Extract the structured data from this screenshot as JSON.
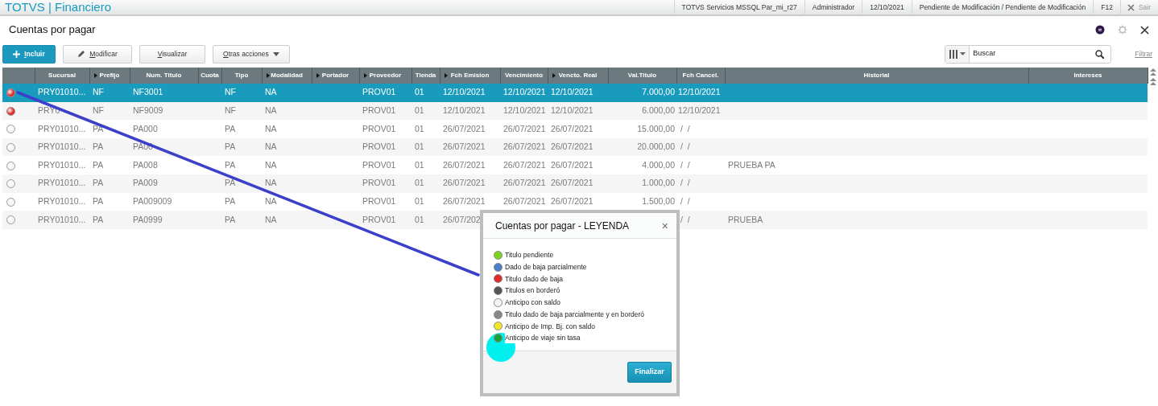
{
  "app_bar": {
    "title": "TOTVS | Financiero",
    "items": [
      "TOTVS Servicios MSSQL Par_mi_r27",
      "Administrador",
      "12/10/2021",
      "Pendiente de Modificación / Pendiente de Modificación",
      "F12"
    ],
    "exit": "Sair"
  },
  "page": {
    "title": "Cuentas por pagar"
  },
  "toolbar": {
    "buttons": [
      {
        "label": "Incluir",
        "kind": "primary"
      },
      {
        "label": "Modificar",
        "kind": "edit"
      },
      {
        "label": "Visualizar",
        "kind": "plain"
      },
      {
        "label": "Otras acciones",
        "kind": "dropdown"
      }
    ],
    "search": {
      "placeholder": "Buscar"
    },
    "filter": "Filtrar"
  },
  "table": {
    "columns": [
      {
        "label": "Sucursal",
        "sort_arrow": false
      },
      {
        "label": "Prefijo",
        "sort_arrow": true
      },
      {
        "label": "Num. Titulo",
        "sort_arrow": false
      },
      {
        "label": "Cuota",
        "sort_arrow": false
      },
      {
        "label": "Tipo",
        "sort_arrow": false
      },
      {
        "label": "Modalidad",
        "sort_arrow": true
      },
      {
        "label": "Portador",
        "sort_arrow": true
      },
      {
        "label": "Proveedor",
        "sort_arrow": true
      },
      {
        "label": "Tienda",
        "sort_arrow": false
      },
      {
        "label": "Fch Emision",
        "sort_arrow": true
      },
      {
        "label": "Vencimiento",
        "sort_arrow": false
      },
      {
        "label": "Vencto. Real",
        "sort_arrow": true
      },
      {
        "label": "Val.Titulo",
        "sort_arrow": false
      },
      {
        "label": "Fch Cancel.",
        "sort_arrow": false
      },
      {
        "label": "Historial",
        "sort_arrow": false
      },
      {
        "label": "Intereses",
        "sort_arrow": false
      }
    ],
    "rows": [
      {
        "color": "#e02b2b",
        "selected": true,
        "cells": [
          "PRY01010...",
          "NF",
          "NF3001",
          null,
          "NF",
          "NA",
          null,
          "PROV01",
          "01",
          "12/10/2021",
          "12/10/2021",
          "12/10/2021",
          "7.000,00",
          "12/10/2021",
          null,
          null
        ]
      },
      {
        "color": "#e02b2b",
        "selected": false,
        "cells": [
          "PRY0",
          "NF",
          "NF9009",
          null,
          "NF",
          "NA",
          null,
          "PROV01",
          "01",
          "12/10/2021",
          "12/10/2021",
          "12/10/2021",
          "6.000,00",
          "12/10/2021",
          null,
          null
        ]
      },
      {
        "color": "#f4f4f4",
        "selected": false,
        "cells": [
          "PRY01010...",
          "PA",
          "PA000",
          null,
          "PA",
          "NA",
          null,
          "PROV01",
          "01",
          "26/07/2021",
          "26/07/2021",
          "26/07/2021",
          "15.000,00",
          " /  /",
          null,
          null
        ]
      },
      {
        "color": "#f4f4f4",
        "selected": false,
        "cells": [
          "PRY01010...",
          "PA",
          "PA00",
          null,
          "PA",
          "NA",
          null,
          "PROV01",
          "01",
          "26/07/2021",
          "26/07/2021",
          "26/07/2021",
          "20.000,00",
          " /  /",
          null,
          null
        ]
      },
      {
        "color": "#f4f4f4",
        "selected": false,
        "cells": [
          "PRY01010...",
          "PA",
          "PA008",
          null,
          "PA",
          "NA",
          null,
          "PROV01",
          "01",
          "26/07/2021",
          "26/07/2021",
          "26/07/2021",
          "4.000,00",
          " /  /",
          "PRUEBA PA",
          null
        ]
      },
      {
        "color": "#f4f4f4",
        "selected": false,
        "cells": [
          "PRY01010...",
          "PA",
          "PA009",
          null,
          "PA",
          "NA",
          null,
          "PROV01",
          "01",
          "26/07/2021",
          "26/07/2021",
          "26/07/2021",
          "1.000,00",
          " /  /",
          null,
          null
        ]
      },
      {
        "color": "#f4f4f4",
        "selected": false,
        "cells": [
          "PRY01010...",
          "PA",
          "PA009009",
          null,
          "PA",
          "NA",
          null,
          "PROV01",
          "01",
          "26/07/2021",
          "26/07/2021",
          "26/07/2021",
          "1.500,00",
          " /  /",
          null,
          null
        ]
      },
      {
        "color": "#f4f4f4",
        "selected": false,
        "cells": [
          "PRY01010...",
          "PA",
          "PA0999",
          null,
          "PA",
          "NA",
          null,
          "PROV01",
          "01",
          "26/07/202",
          null,
          null,
          null,
          " /  /",
          "PRUEBA",
          null
        ]
      }
    ]
  },
  "legend_dialog": {
    "title": "Cuentas por pagar - LEYENDA",
    "close": "×",
    "items": [
      {
        "label": "Titulo pendiente",
        "color": "#7ed321"
      },
      {
        "label": "Dado de baja parcialmente",
        "color": "#4a7fc1"
      },
      {
        "label": "Titulo dado de baja",
        "color": "#e02b2b"
      },
      {
        "label": "Titulos en borderó",
        "color": "#555555"
      },
      {
        "label": "Anticipo con saldo",
        "color": "#f4f4f4"
      },
      {
        "label": "Titulo dado de baja parcialmente y en borderó",
        "color": "#888888"
      },
      {
        "label": "Anticipo de Imp. Bj. con saldo",
        "color": "#f0e62a"
      },
      {
        "label": "Anticipo de viaje sin tasa",
        "color": "#1e9e3a"
      }
    ],
    "button": "Finalizar"
  }
}
